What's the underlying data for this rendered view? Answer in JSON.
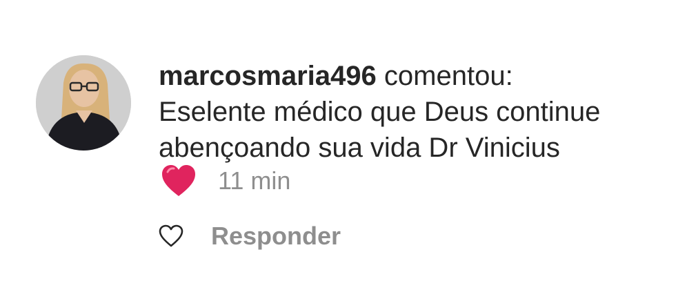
{
  "comment": {
    "username": "marcosmaria496",
    "action": "comentou:",
    "text_line1": "Eselente médico que Deus continue",
    "text_line2": "abençoando sua vida Dr Vinicius",
    "reaction_icon": "red-heart-emoji",
    "time": "11 min"
  },
  "actions": {
    "like_icon": "heart-outline-icon",
    "reply_label": "Responder"
  },
  "colors": {
    "text": "#262626",
    "muted": "#8e8e8e",
    "heart": "#e0245e"
  }
}
